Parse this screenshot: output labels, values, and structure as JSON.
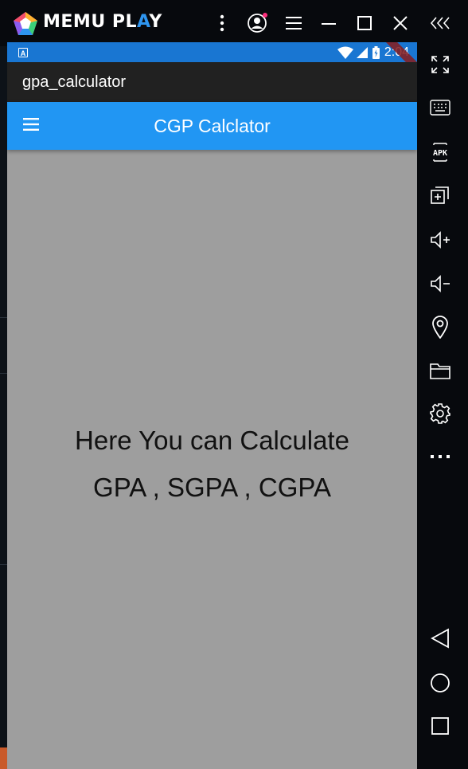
{
  "emulator": {
    "brand_prefix": "MEMU PL",
    "brand_a": "A",
    "brand_suffix": "Y",
    "accent_color": "#2e95f0",
    "title_buttons": [
      "more-vertical-icon",
      "account-icon",
      "menu-lines-icon",
      "minimize-icon",
      "maximize-icon",
      "close-icon",
      "collapse-sidebar-icon"
    ],
    "sidebar_buttons": [
      "fullscreen-icon",
      "keyboard-icon",
      "apk-icon",
      "multi-instance-icon",
      "volume-up-icon",
      "volume-down-icon",
      "location-icon",
      "folder-icon",
      "settings-icon",
      "more-horizontal-icon",
      "back-icon",
      "home-icon",
      "recents-icon"
    ],
    "apk_label": "APK"
  },
  "android": {
    "status_bar": {
      "notification_letter": "A",
      "time": "2:04",
      "color": "#1976d2"
    },
    "app_title": "gpa_calculator",
    "app_bar": {
      "title": "CGP Calclator",
      "color": "#2196f3"
    },
    "body": {
      "line1": "Here You can Calculate",
      "line2": "GPA , SGPA , CGPA",
      "background": "#9e9e9e"
    }
  }
}
